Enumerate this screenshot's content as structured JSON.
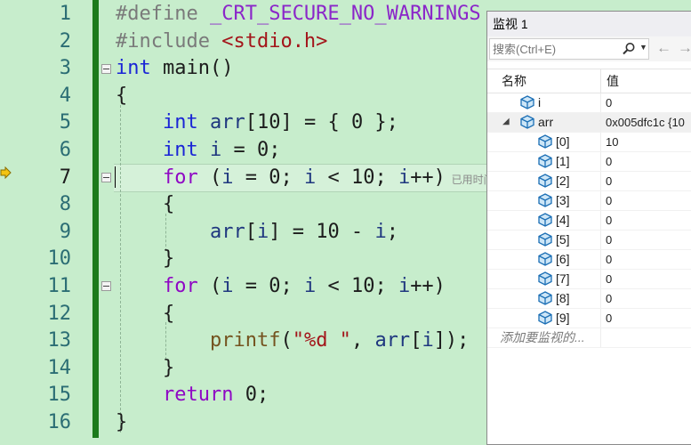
{
  "editor": {
    "line_numbers": [
      "1",
      "2",
      "3",
      "4",
      "5",
      "6",
      "7",
      "8",
      "9",
      "10",
      "11",
      "12",
      "13",
      "14",
      "15",
      "16"
    ],
    "current_line": "7",
    "inline_hint": "已用时间",
    "lines": [
      [
        {
          "t": "#define ",
          "c": "pp"
        },
        {
          "t": "_CRT_SECURE_NO_WARNINGS",
          "c": "macro"
        }
      ],
      [
        {
          "t": "#include ",
          "c": "pp"
        },
        {
          "t": "<stdio.h>",
          "c": "hdr"
        }
      ],
      [
        {
          "t": "int",
          "c": "kw"
        },
        {
          "t": " main()",
          "c": ""
        }
      ],
      [
        {
          "t": "{",
          "c": ""
        }
      ],
      [
        {
          "t": "    ",
          "c": ""
        },
        {
          "t": "int",
          "c": "kw"
        },
        {
          "t": " ",
          "c": ""
        },
        {
          "t": "arr",
          "c": "var"
        },
        {
          "t": "[10] = { 0 };",
          "c": ""
        }
      ],
      [
        {
          "t": "    ",
          "c": ""
        },
        {
          "t": "int",
          "c": "kw"
        },
        {
          "t": " ",
          "c": ""
        },
        {
          "t": "i",
          "c": "var"
        },
        {
          "t": " = 0;",
          "c": ""
        }
      ],
      [
        {
          "t": "    ",
          "c": ""
        },
        {
          "t": "for",
          "c": "kw2"
        },
        {
          "t": " (",
          "c": ""
        },
        {
          "t": "i",
          "c": "var"
        },
        {
          "t": " = 0; ",
          "c": ""
        },
        {
          "t": "i",
          "c": "var"
        },
        {
          "t": " < 10; ",
          "c": ""
        },
        {
          "t": "i",
          "c": "var"
        },
        {
          "t": "++)",
          "c": ""
        }
      ],
      [
        {
          "t": "    {",
          "c": ""
        }
      ],
      [
        {
          "t": "        ",
          "c": ""
        },
        {
          "t": "arr",
          "c": "var"
        },
        {
          "t": "[",
          "c": ""
        },
        {
          "t": "i",
          "c": "var"
        },
        {
          "t": "] = 10 - ",
          "c": ""
        },
        {
          "t": "i",
          "c": "var"
        },
        {
          "t": ";",
          "c": ""
        }
      ],
      [
        {
          "t": "    }",
          "c": ""
        }
      ],
      [
        {
          "t": "    ",
          "c": ""
        },
        {
          "t": "for",
          "c": "kw2"
        },
        {
          "t": " (",
          "c": ""
        },
        {
          "t": "i",
          "c": "var"
        },
        {
          "t": " = 0; ",
          "c": ""
        },
        {
          "t": "i",
          "c": "var"
        },
        {
          "t": " < 10; ",
          "c": ""
        },
        {
          "t": "i",
          "c": "var"
        },
        {
          "t": "++)",
          "c": ""
        }
      ],
      [
        {
          "t": "    {",
          "c": ""
        }
      ],
      [
        {
          "t": "        ",
          "c": ""
        },
        {
          "t": "printf",
          "c": "fn"
        },
        {
          "t": "(",
          "c": ""
        },
        {
          "t": "\"%d \"",
          "c": "str"
        },
        {
          "t": ", ",
          "c": ""
        },
        {
          "t": "arr",
          "c": "var"
        },
        {
          "t": "[",
          "c": ""
        },
        {
          "t": "i",
          "c": "var"
        },
        {
          "t": "]);",
          "c": ""
        }
      ],
      [
        {
          "t": "    }",
          "c": ""
        }
      ],
      [
        {
          "t": "    ",
          "c": ""
        },
        {
          "t": "return",
          "c": "kw2"
        },
        {
          "t": " 0;",
          "c": ""
        }
      ],
      [
        {
          "t": "}",
          "c": ""
        }
      ]
    ]
  },
  "watch": {
    "title": "监视 1",
    "search_placeholder": "搜索(Ctrl+E)",
    "columns": {
      "name": "名称",
      "value": "值"
    },
    "rows": [
      {
        "name": "i",
        "value": "0",
        "level": 0,
        "expanded": null
      },
      {
        "name": "arr",
        "value": "0x005dfc1c {10",
        "level": 0,
        "expanded": true
      },
      {
        "name": "[0]",
        "value": "10",
        "level": 1,
        "expanded": null
      },
      {
        "name": "[1]",
        "value": "0",
        "level": 1,
        "expanded": null
      },
      {
        "name": "[2]",
        "value": "0",
        "level": 1,
        "expanded": null
      },
      {
        "name": "[3]",
        "value": "0",
        "level": 1,
        "expanded": null
      },
      {
        "name": "[4]",
        "value": "0",
        "level": 1,
        "expanded": null
      },
      {
        "name": "[5]",
        "value": "0",
        "level": 1,
        "expanded": null
      },
      {
        "name": "[6]",
        "value": "0",
        "level": 1,
        "expanded": null
      },
      {
        "name": "[7]",
        "value": "0",
        "level": 1,
        "expanded": null
      },
      {
        "name": "[8]",
        "value": "0",
        "level": 1,
        "expanded": null
      },
      {
        "name": "[9]",
        "value": "0",
        "level": 1,
        "expanded": null
      }
    ],
    "add_watch_placeholder": "添加要监视的..."
  },
  "colors": {
    "editor_background": "#c7edcc",
    "change_bar": "#1b7b1b",
    "keyword": "#1a25d6",
    "control_keyword": "#8f08c4",
    "string": "#a3151a",
    "function": "#74531f",
    "variable": "#1f377f",
    "line_number": "#2b6d74",
    "execution_arrow": "#f3c313"
  },
  "icons": [
    "current-statement-arrow-icon",
    "search-icon",
    "dropdown-arrow-icon",
    "back-arrow-icon",
    "forward-arrow-icon",
    "variable-cube-icon",
    "expand-triangle-icon",
    "collapse-box-icon"
  ]
}
